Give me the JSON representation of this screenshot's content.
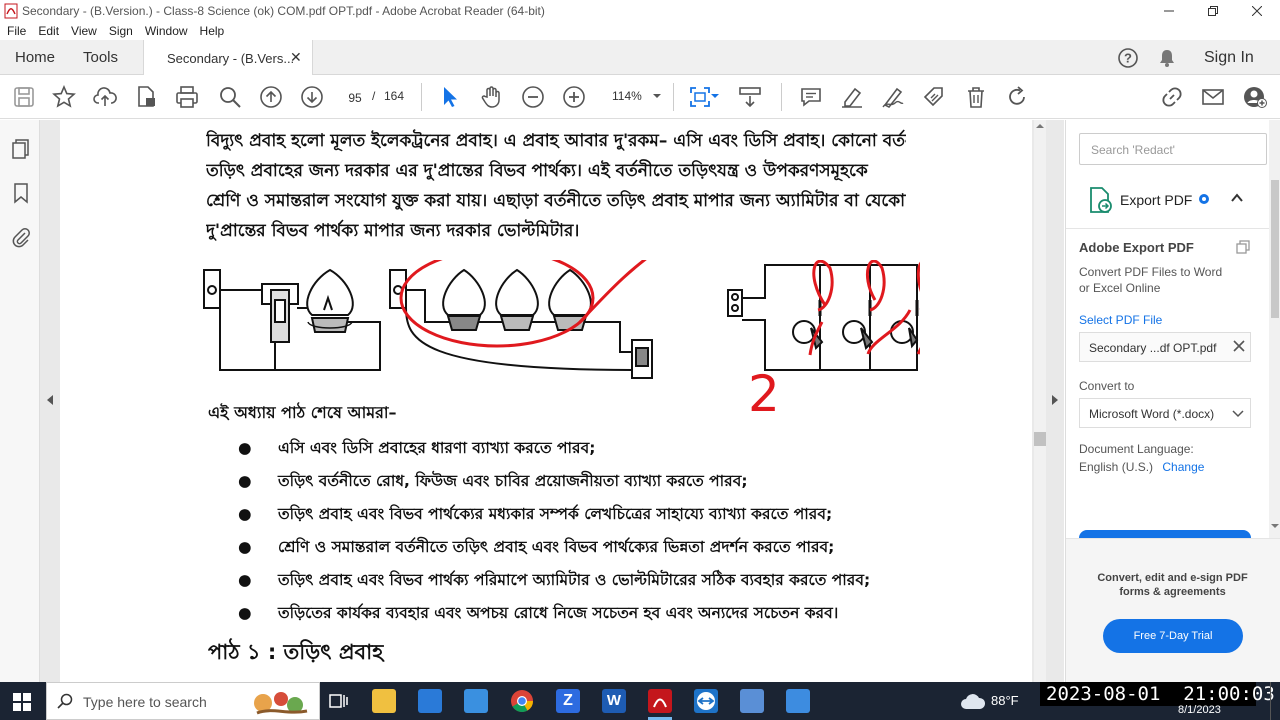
{
  "window": {
    "title": "Secondary - (B.Version.) - Class-8 Science (ok) COM.pdf OPT.pdf - Adobe Acrobat Reader (64-bit)"
  },
  "menu": [
    "File",
    "Edit",
    "View",
    "Sign",
    "Window",
    "Help"
  ],
  "tabs": {
    "home": "Home",
    "tools": "Tools",
    "active": "Secondary - (B.Vers...",
    "sign_in": "Sign In"
  },
  "toolbar": {
    "page_current": "95",
    "page_sep": "/",
    "page_total": "164",
    "zoom": "114%"
  },
  "document": {
    "intro_lines": [
      "বিদ্যুৎ প্রবাহ হলো মূলত ইলেকট্রনের প্রবাহ। এ প্রবাহ আবার দু'রকম– এসি এবং ডিসি প্রবাহ। কোনো বর্তনীতে",
      "তড়িৎ প্রবাহের জন্য দরকার এর দু'প্রান্তের বিভব পার্থক্য। এই বর্তনীতে তড়িৎযন্ত্র ও উপকরণসমূহকে",
      "শ্রেণি ও সমান্তরাল সংযোগ যুক্ত করা যায়। এছাড়া বর্তনীতে তড়িৎ প্রবাহ মাপার জন্য অ্যামিটার বা যেকোনো",
      "দু'প্রান্তের বিভব পার্থক্য মাপার জন্য দরকার ভোল্টমিটার।"
    ],
    "annotation_digit": "2",
    "learn_heading": "এই অধ্যায় পাঠ শেষে আমরা–",
    "bullets": [
      "এসি এবং ডিসি প্রবাহের ধারণা ব্যাখ্যা করতে পারব;",
      "তড়িৎ বর্তনীতে রোধ, ফিউজ এবং চাবির প্রয়োজনীয়তা ব্যাখ্যা করতে পারব;",
      "তড়িৎ প্রবাহ এবং বিভব পার্থক্যের মধ্যকার সম্পর্ক লেখচিত্রের সাহায্যে ব্যাখ্যা করতে পারব;",
      "শ্রেণি ও সমান্তরাল বর্তনীতে তড়িৎ প্রবাহ এবং বিভব পার্থক্যের ভিন্নতা প্রদর্শন করতে পারব;",
      "তড়িৎ প্রবাহ এবং বিভব পার্থক্য পরিমাপে অ্যামিটার ও ভোল্টমিটারের সঠিক ব্যবহার করতে পারব;",
      "তড়িতের কার্যকর ব্যবহার এবং অপচয় রোধে নিজে সচেতন হব এবং অন্যদের সচেতন করব।"
    ],
    "lesson_heading": "পাঠ ১ : তড়িৎ প্রবাহ"
  },
  "right_panel": {
    "search_placeholder": "Search 'Redact'",
    "export_title": "Export PDF",
    "adobe_export_heading": "Adobe Export PDF",
    "adobe_export_desc_1": "Convert PDF Files to Word",
    "adobe_export_desc_2": "or Excel Online",
    "select_file_link": "Select PDF File",
    "selected_file": "Secondary ...df OPT.pdf",
    "convert_to_label": "Convert to",
    "convert_to_value": "Microsoft Word (*.docx)",
    "doc_language_label": "Document Language:",
    "doc_language_value": "English (U.S.)",
    "change_link": "Change",
    "promo_line_1": "Convert, edit and e-sign PDF",
    "promo_line_2": "forms & agreements",
    "trial_button": "Free 7-Day Trial"
  },
  "taskbar": {
    "search_placeholder": "Type here to search",
    "weather_temp": "88°F",
    "clock_overlay": "2023-08-01  21:00:03",
    "tray_date": "8/1/2023"
  },
  "colors": {
    "accent_blue": "#1473e6",
    "annotation_red": "#e0191e",
    "taskbar_bg": "#1b2433"
  }
}
